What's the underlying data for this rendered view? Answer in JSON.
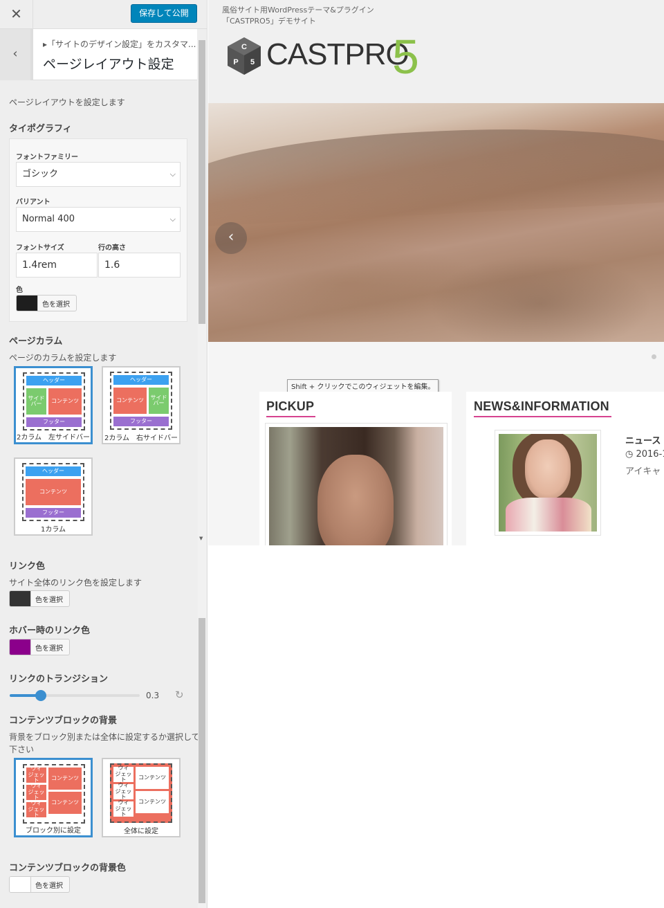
{
  "header": {
    "close_icon": "close-icon",
    "publish_label": "保存して公開"
  },
  "section": {
    "breadcrumb": "▸「サイトのデザイン設定」をカスタマ...",
    "title": "ページレイアウト設定",
    "description": "ページレイアウトを設定します"
  },
  "typography": {
    "heading": "タイポグラフィ",
    "font_family_label": "フォントファミリー",
    "font_family_value": "ゴシック",
    "variant_label": "バリアント",
    "variant_value": "Normal 400",
    "font_size_label": "フォントサイズ",
    "font_size_value": "1.4rem",
    "line_height_label": "行の高さ",
    "line_height_value": "1.6",
    "color_label": "色",
    "color_button": "色を選択",
    "color_value": "#1e1e1e"
  },
  "columns": {
    "heading": "ページカラム",
    "description": "ページのカラムを設定します",
    "block_labels": {
      "header": "ヘッダー",
      "footer": "フッター",
      "content": "コンテンツ",
      "sidebar_line1": "サイド",
      "sidebar_line2": "バー"
    },
    "options": [
      {
        "caption": "2カラム　左サイドバー",
        "selected": true
      },
      {
        "caption": "2カラム　右サイドバー",
        "selected": false
      },
      {
        "caption": "1カラム",
        "selected": false
      }
    ]
  },
  "link_color": {
    "heading": "リンク色",
    "description": "サイト全体のリンク色を設定します",
    "button": "色を選択",
    "value": "#333333"
  },
  "hover_color": {
    "heading": "ホバー時のリンク色",
    "button": "色を選択",
    "value": "#8b008b"
  },
  "transition": {
    "heading": "リンクのトランジション",
    "value": "0.3",
    "fraction": 0.24
  },
  "content_bg": {
    "heading": "コンテンツブロックの背景",
    "description_line1": "背景をブロック別または全体に設定するか選択して",
    "description_line2": "下さい",
    "widget_line1": "ウィ",
    "widget_line2": "ジェット",
    "content_label": "コンテンツ",
    "options": [
      {
        "caption": "ブロック別に設定",
        "selected": true
      },
      {
        "caption": "全体に設定",
        "selected": false
      }
    ]
  },
  "content_bg_color": {
    "heading": "コンテンツブロックの背景色",
    "button": "色を選択",
    "value": "#ffffff"
  },
  "preview": {
    "tagline_line1": "風俗サイト用WordPressテーマ&プラグイン",
    "tagline_line2": "「CASTPRO5」デモサイト",
    "logo_text": "CASTPRO",
    "logo_number": "5",
    "logo_cube_letters": [
      "C",
      "P",
      "5"
    ],
    "slider_prev_icon": "chevron-left-icon",
    "tooltip": "Shift + クリックでこのウィジェットを編集。",
    "pickup_title": "PICKUP",
    "news_heading": "NEWS&INFORMATION",
    "news_item_title": "ニュース",
    "news_item_date": "2016-1",
    "news_item_excerpt": "アイキャ",
    "accent_color": "#d6428f",
    "brand_green": "#8cc14b"
  }
}
